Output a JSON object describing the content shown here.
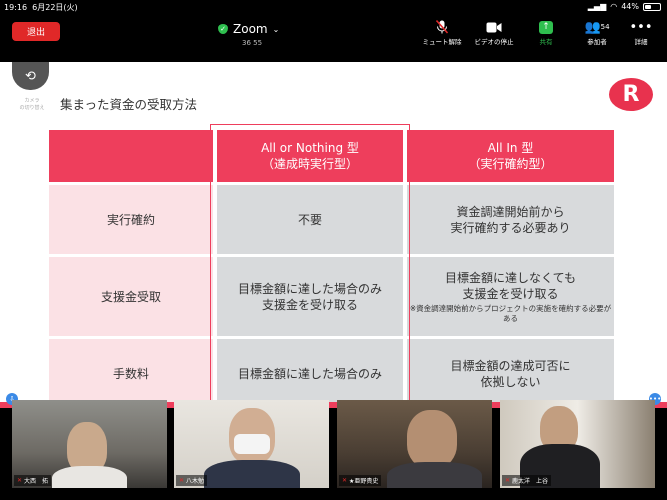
{
  "status_bar": {
    "time": "19:16",
    "date": "6月22日(火)",
    "battery": "44%",
    "battery_level": 0.44
  },
  "toolbar": {
    "leave_label": "退出",
    "app_title": "Zoom",
    "meeting_timer": "36 55",
    "tools": [
      {
        "icon": "mic-muted-icon",
        "label": "ミュート解除"
      },
      {
        "icon": "video-camera-icon",
        "label": "ビデオの停止"
      },
      {
        "icon": "share-icon",
        "label": "共有"
      },
      {
        "icon": "participants-icon",
        "label": "参加者",
        "count": "54"
      },
      {
        "icon": "more-icon",
        "label": "詳細"
      }
    ]
  },
  "camera_switch": {
    "label_line1": "カメラ",
    "label_line2": "の切り替え"
  },
  "slide": {
    "title": "集まった資金の受取方法",
    "logo_text": "R",
    "headers": {
      "col2_line1": "All or Nothing 型",
      "col2_line2": "（達成時実行型）",
      "col3_line1": "All In 型",
      "col3_line2": "（実行確約型）"
    },
    "rows": [
      {
        "label": "実行確約",
        "col2": [
          "不要"
        ],
        "col3": [
          "資金調達開始前から",
          "実行確約する必要あり"
        ],
        "note": ""
      },
      {
        "label": "支援金受取",
        "col2": [
          "目標金額に達した場合のみ",
          "支援金を受け取る"
        ],
        "col3": [
          "目標金額に達しなくても",
          "支援金を受け取る"
        ],
        "note": "※資金調達開始前からプロジェクトの実施を確約する必要がある"
      },
      {
        "label": "手数料",
        "col2": [
          "目標金額に達した場合のみ"
        ],
        "col3": [
          "目標金額の達成可否に",
          "依拠しない"
        ],
        "note": ""
      }
    ]
  },
  "colors": {
    "accent": "#ee3e5c",
    "leave": "#e02828",
    "share": "#2fbf4f"
  },
  "participants": [
    {
      "name": "大西　拓"
    },
    {
      "name": "八木勉"
    },
    {
      "name": "★亜野貴史"
    },
    {
      "name": "鹿太洋　上谷"
    }
  ]
}
